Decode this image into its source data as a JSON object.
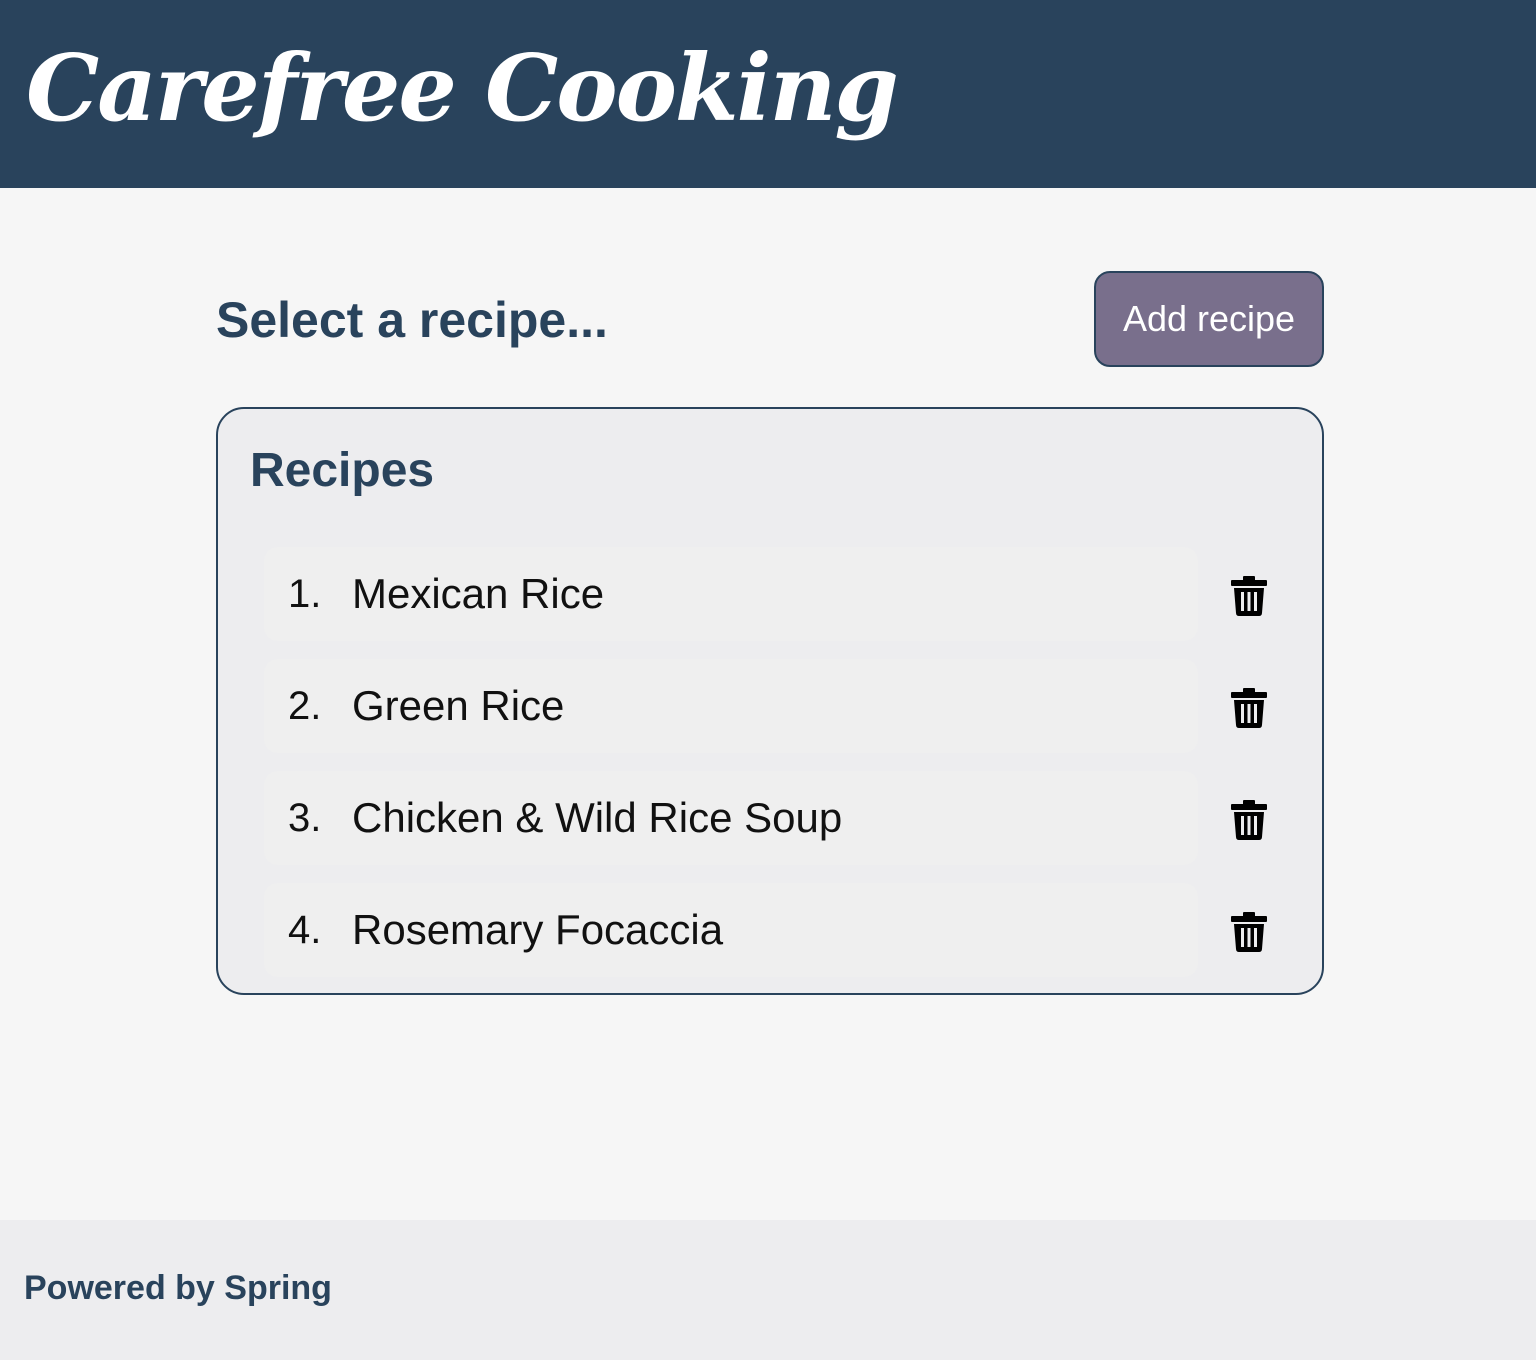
{
  "header": {
    "brand": "Carefree Cooking"
  },
  "main": {
    "heading": "Select a recipe...",
    "add_button_label": "Add recipe"
  },
  "recipes": {
    "title": "Recipes",
    "items": [
      {
        "number": "1.",
        "name": "Mexican Rice",
        "action_icon": "trash-icon"
      },
      {
        "number": "2.",
        "name": "Green Rice",
        "action_icon": "trash-icon"
      },
      {
        "number": "3.",
        "name": "Chicken & Wild Rice Soup",
        "action_icon": "trash-icon"
      },
      {
        "number": "4.",
        "name": "Rosemary Focaccia",
        "action_icon": "trash-icon"
      }
    ]
  },
  "footer": {
    "text": "Powered by Spring"
  },
  "colors": {
    "header_bg": "#29435c",
    "accent_button": "#796f8c",
    "card_bg": "#ededef",
    "page_bg": "#f6f6f6"
  }
}
